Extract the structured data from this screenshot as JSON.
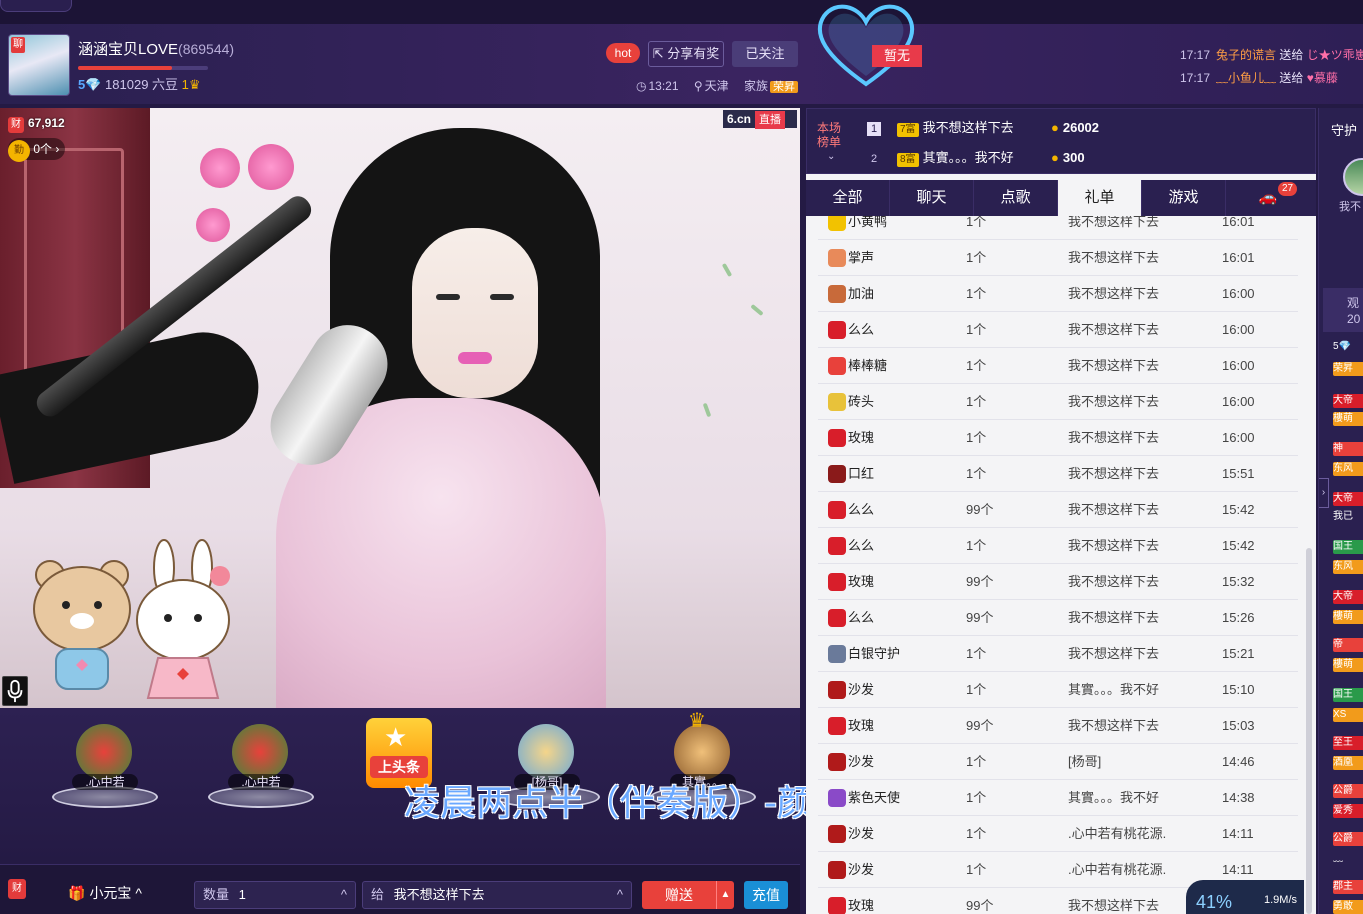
{
  "header": {
    "anchor_name": "涵涵宝贝LOVE",
    "room_id": "(869544)",
    "level_num": "5",
    "coins": "181029 六豆",
    "crown_level": "1",
    "hot_label": "hot",
    "share_label": "分享有奖",
    "follow_label": "已关注",
    "time": "13:21",
    "city": "天津",
    "family_label": "家族",
    "family_tag": "荣昇",
    "zanwu": "暂无",
    "level_progress": 0.72
  },
  "gift_feed": [
    {
      "time": "17:17",
      "from": "兔子的谎言",
      "verb": "送给",
      "to": "じ★ツ乖崽"
    },
    {
      "time": "17:17",
      "from": "﹏小鱼儿﹏",
      "verb": "送给",
      "to": "♥慕藤"
    }
  ],
  "video": {
    "wealth_value": "67,912",
    "fan_label": "0个",
    "watermark_brand": "6.cn",
    "watermark_live": "直播",
    "song_caption": "凌晨两点半（伴奏版）-颜亚涛"
  },
  "seats": [
    {
      "name": ".心中若"
    },
    {
      "name": ".心中若"
    },
    {
      "name": "[杨哥]"
    },
    {
      "name": "其實。。"
    }
  ],
  "headline_label": "上头条",
  "bottom": {
    "gift_label": "小元宝",
    "qty_label": "数量",
    "qty_value": "1",
    "to_label": "给",
    "to_value": "我不想这样下去",
    "send_label": "赠送",
    "charge_label": "充值"
  },
  "rank": {
    "label": "本场榜单",
    "rows": [
      {
        "num": "1",
        "crest": "7富",
        "name": "我不想这样下去",
        "amount": "26002"
      },
      {
        "num": "2",
        "crest": "8富",
        "name": "其實。。。我不好",
        "amount": "300"
      }
    ]
  },
  "tabs": [
    {
      "label": "全部"
    },
    {
      "label": "聊天"
    },
    {
      "label": "点歌"
    },
    {
      "label": "礼单"
    },
    {
      "label": "游戏"
    }
  ],
  "car_badge": "27",
  "gift_list": [
    {
      "gift": "小黄鸭",
      "count": "1个",
      "user": "我不想这样下去",
      "time": "16:01",
      "color": "#f2c200"
    },
    {
      "gift": "掌声",
      "count": "1个",
      "user": "我不想这样下去",
      "time": "16:01",
      "color": "#e88a5a"
    },
    {
      "gift": "加油",
      "count": "1个",
      "user": "我不想这样下去",
      "time": "16:00",
      "color": "#c86a3a"
    },
    {
      "gift": "么么",
      "count": "1个",
      "user": "我不想这样下去",
      "time": "16:00",
      "color": "#d81e2a"
    },
    {
      "gift": "棒棒糖",
      "count": "1个",
      "user": "我不想这样下去",
      "time": "16:00",
      "color": "#e8413b"
    },
    {
      "gift": "砖头",
      "count": "1个",
      "user": "我不想这样下去",
      "time": "16:00",
      "color": "#e8c23a"
    },
    {
      "gift": "玫瑰",
      "count": "1个",
      "user": "我不想这样下去",
      "time": "16:00",
      "color": "#d81e2a"
    },
    {
      "gift": "口红",
      "count": "1个",
      "user": "我不想这样下去",
      "time": "15:51",
      "color": "#8a1a1a"
    },
    {
      "gift": "么么",
      "count": "99个",
      "user": "我不想这样下去",
      "time": "15:42",
      "color": "#d81e2a"
    },
    {
      "gift": "么么",
      "count": "1个",
      "user": "我不想这样下去",
      "time": "15:42",
      "color": "#d81e2a"
    },
    {
      "gift": "玫瑰",
      "count": "99个",
      "user": "我不想这样下去",
      "time": "15:32",
      "color": "#d81e2a"
    },
    {
      "gift": "么么",
      "count": "99个",
      "user": "我不想这样下去",
      "time": "15:26",
      "color": "#d81e2a"
    },
    {
      "gift": "白银守护",
      "count": "1个",
      "user": "我不想这样下去",
      "time": "15:21",
      "color": "#6a7a9a"
    },
    {
      "gift": "沙发",
      "count": "1个",
      "user": "其實。。。我不好",
      "time": "15:10",
      "color": "#b01a1a"
    },
    {
      "gift": "玫瑰",
      "count": "99个",
      "user": "我不想这样下去",
      "time": "15:03",
      "color": "#d81e2a"
    },
    {
      "gift": "沙发",
      "count": "1个",
      "user": "[杨哥]",
      "time": "14:46",
      "color": "#b01a1a"
    },
    {
      "gift": "紫色天使",
      "count": "1个",
      "user": "其實。。。我不好",
      "time": "14:38",
      "color": "#8a4ac8"
    },
    {
      "gift": "沙发",
      "count": "1个",
      "user": ".心中若有桃花源.",
      "time": "14:11",
      "color": "#b01a1a"
    },
    {
      "gift": "沙发",
      "count": "1个",
      "user": ".心中若有桃花源.",
      "time": "14:11",
      "color": "#b01a1a"
    },
    {
      "gift": "玫瑰",
      "count": "99个",
      "user": "我不想这样下去",
      "time": "",
      "color": "#d81e2a"
    }
  ],
  "speed": {
    "pct": "41%",
    "rate": "1.9M/s"
  },
  "guard": {
    "title": "守护",
    "name": "我不",
    "watch_label": "观",
    "watch_num": "20",
    "badges": [
      {
        "text": "5💎",
        "color": "#2a2050"
      },
      {
        "text": "荣昇",
        "color": "#f29b1b"
      },
      {
        "text": "大帝",
        "color": "#d81e2a"
      },
      {
        "text": "樓萌",
        "color": "#f29b1b"
      },
      {
        "text": "神",
        "color": "#e8413b"
      },
      {
        "text": "东风",
        "color": "#f29b1b"
      },
      {
        "text": "大帝",
        "color": "#d81e2a"
      },
      {
        "text": "我已",
        "color": "#2a2050"
      },
      {
        "text": "国王",
        "color": "#2a9a4a"
      },
      {
        "text": "东风",
        "color": "#f29b1b"
      },
      {
        "text": "大帝",
        "color": "#d81e2a"
      },
      {
        "text": "樓萌",
        "color": "#f29b1b"
      },
      {
        "text": "帝",
        "color": "#e8413b"
      },
      {
        "text": "樓萌",
        "color": "#f29b1b"
      },
      {
        "text": "国王",
        "color": "#2a9a4a"
      },
      {
        "text": "XS",
        "color": "#f29b1b"
      },
      {
        "text": "至王",
        "color": "#d81e2a"
      },
      {
        "text": "酒凰",
        "color": "#f29b1b"
      },
      {
        "text": "公爵",
        "color": "#e8413b"
      },
      {
        "text": "爱秀",
        "color": "#d81e2a"
      },
      {
        "text": "公爵",
        "color": "#e8413b"
      },
      {
        "text": "﹏",
        "color": "#2a2050"
      },
      {
        "text": "郡主",
        "color": "#e8413b"
      },
      {
        "text": "勇敢",
        "color": "#f29b1b"
      }
    ]
  },
  "colors": {
    "accent_red": "#e8413b",
    "panel_purple": "#2a2050",
    "charge_blue": "#1a8fd6"
  }
}
